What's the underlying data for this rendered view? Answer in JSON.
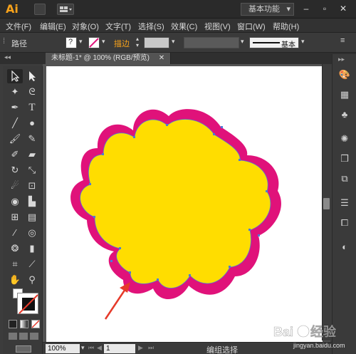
{
  "app": {
    "logo": "Ai",
    "workspace": "基本功能"
  },
  "window_controls": {
    "minimize": "–",
    "restore": "▫",
    "close": "✕"
  },
  "menu": [
    "文件(F)",
    "编辑(E)",
    "对象(O)",
    "文字(T)",
    "选择(S)",
    "效果(C)",
    "视图(V)",
    "窗口(W)",
    "帮助(H)"
  ],
  "control_bar": {
    "path_label": "路径",
    "stroke_label": "描边",
    "brush_preset": "基本"
  },
  "document": {
    "tab_title": "未标题-1* @ 100% (RGB/预览)"
  },
  "status": {
    "zoom": "100%",
    "page": "1",
    "message": "编组选择"
  },
  "colors": {
    "accent": "#f7a21b",
    "shape_fill": "#ffdd00",
    "shape_stroke": "#e0127a",
    "path_points": "#4c7bd6",
    "arrow": "#e63a2a"
  },
  "watermark": {
    "brand": "Baidu",
    "suffix": "经验",
    "url": "jingyan.baidu.com"
  },
  "tools": [
    "selection-tool",
    "direct-selection-tool",
    "magic-wand-tool",
    "lasso-tool",
    "pen-tool",
    "type-tool",
    "line-tool",
    "ellipse-tool",
    "paintbrush-tool",
    "pencil-tool",
    "blob-brush-tool",
    "eraser-tool",
    "rotate-tool",
    "scale-tool",
    "warp-tool",
    "free-transform-tool",
    "shape-builder-tool",
    "perspective-grid-tool",
    "mesh-tool",
    "gradient-tool",
    "eyedropper-tool",
    "blend-tool",
    "symbol-sprayer-tool",
    "column-graph-tool",
    "artboard-tool",
    "slice-tool",
    "hand-tool",
    "zoom-tool"
  ],
  "right_panel": [
    "color-panel-icon",
    "color-guide-icon",
    "swatches-icon",
    "brushes-icon",
    "symbols-icon",
    "graphic-styles-icon",
    "appearance-icon",
    "layers-icon",
    "artboards-icon",
    "transparency-icon"
  ]
}
